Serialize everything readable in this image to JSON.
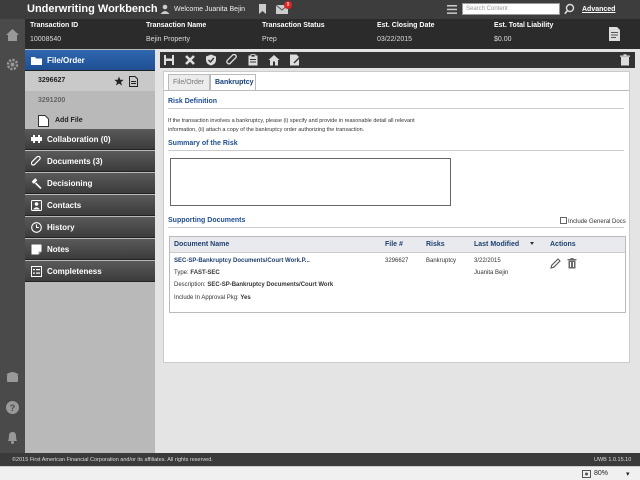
{
  "header": {
    "app_title": "Underwriting Workbench",
    "welcome": "Welcome Juanita Bejin",
    "mail_count": "9",
    "search_placeholder": "Search Content",
    "advanced_label": "Advanced"
  },
  "transaction": {
    "columns": [
      {
        "label": "Transaction ID",
        "value": "10008540"
      },
      {
        "label": "Transaction Name",
        "value": "Bejin Property"
      },
      {
        "label": "Transaction Status",
        "value": "Prep"
      },
      {
        "label": "Est. Closing Date",
        "value": "03/22/2015"
      },
      {
        "label": "Est. Total Liability",
        "value": "$0.00"
      }
    ]
  },
  "sidebar": {
    "file_order": "File/Order",
    "files": [
      "3296627",
      "3291200"
    ],
    "add_file": "Add File",
    "items": [
      {
        "label": "Collaboration (0)"
      },
      {
        "label": "Documents (3)"
      },
      {
        "label": "Decisioning"
      },
      {
        "label": "Contacts"
      },
      {
        "label": "History"
      },
      {
        "label": "Notes"
      },
      {
        "label": "Completeness"
      }
    ]
  },
  "tabs": {
    "file_order": "File/Order",
    "bankruptcy": "Bankruptcy"
  },
  "risk": {
    "definition_title": "Risk Definition",
    "definition_line1": "If the transaction involves a bankruptcy, please (i) specify and provide in reasonable detail all relevant",
    "definition_line2": "information, (ii) attach a copy of the bankruptcy order authorizing the transaction.",
    "summary_title": "Summary of the Risk",
    "supporting_title": "Supporting Documents",
    "include_general": "Include General Docs"
  },
  "doc_table": {
    "headers": {
      "name": "Document Name",
      "file": "File #",
      "risks": "Risks",
      "modified": "Last Modified",
      "actions": "Actions"
    },
    "row": {
      "name": "SEC-SP-Bankruptcy Documents/Court Work.P...",
      "type_label": "Type:",
      "type_value": "FAST-SEC",
      "desc_label": "Description:",
      "desc_value": "SEC-SP-Bankruptcy Documents/Court Work",
      "approval_label": "Include In Approval Pkg:",
      "approval_value": "Yes",
      "file": "3296627",
      "risks": "Bankruptcy",
      "date": "3/22/2015",
      "user": "Juanita Bejin"
    }
  },
  "footer": {
    "copyright": "©2015 First American Financial Corporation and/or its affiliates. All rights reserved.",
    "version": "UWB 1.0.15.10",
    "zoom": "80%"
  }
}
